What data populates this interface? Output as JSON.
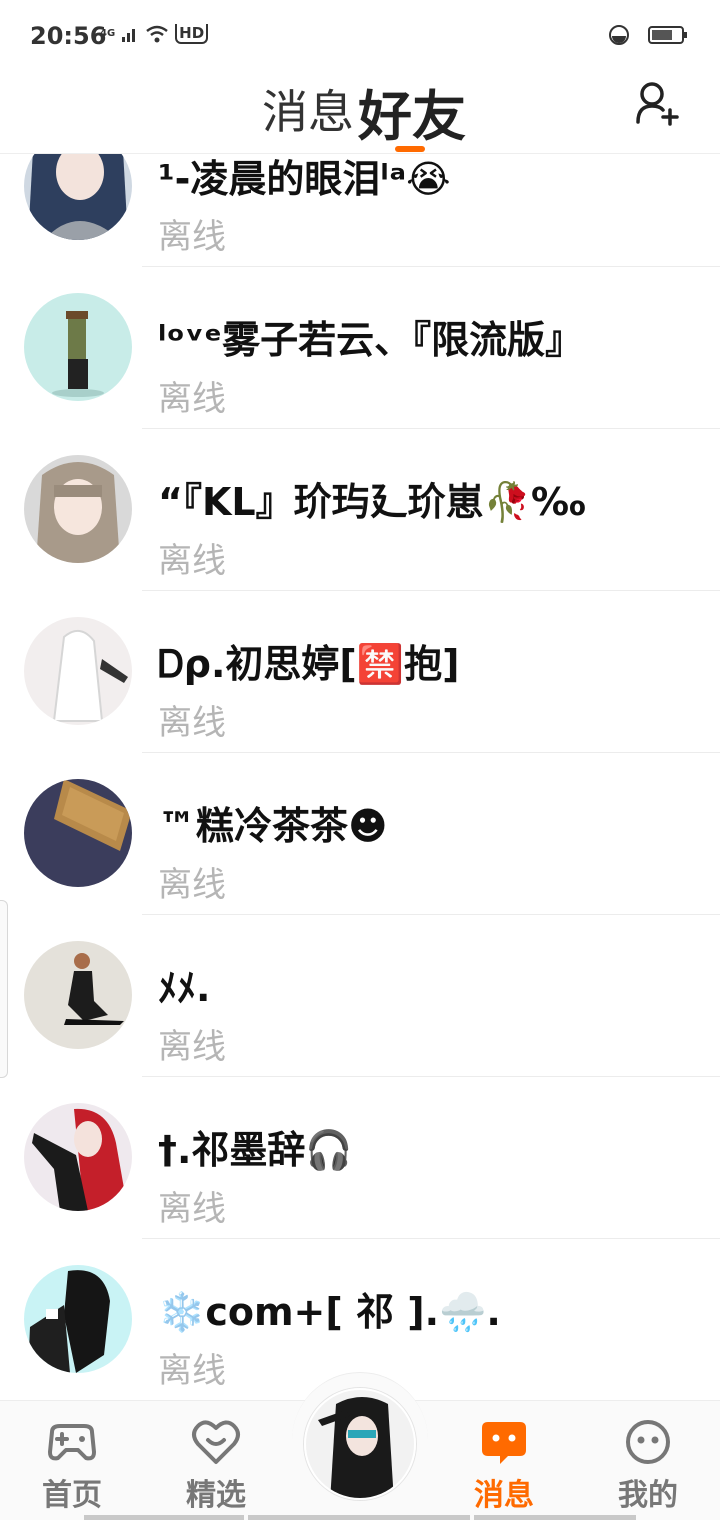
{
  "status_bar": {
    "time": "20:56",
    "network": "4G",
    "hd": "HD"
  },
  "header": {
    "tab_messages": "消息",
    "tab_friends": "好友",
    "accent_color": "#ff6a00"
  },
  "friends": [
    {
      "name": "¹-凌晨的眼泪ˡᵃ😭",
      "status": "离线"
    },
    {
      "name": "ˡᵒᵛᵉ雾子若云、『限流版』",
      "status": "离线"
    },
    {
      "name": "“『KL』玠玙廴玠崽🥀‰",
      "status": "离线"
    },
    {
      "name": "Ꭰρ.初思婷[🈲抱]",
      "status": "离线"
    },
    {
      "name": "™糕冷茶茶☻",
      "status": "离线"
    },
    {
      "name": "ﾒﾒ.",
      "status": "离线"
    },
    {
      "name": "†.祁墨辞🎧",
      "status": "离线"
    },
    {
      "name": "❄️com+[ 祁 ].🌧️.",
      "status": "离线"
    }
  ],
  "bottom_nav": {
    "items": [
      {
        "label": "首页",
        "icon": "gamepad-icon"
      },
      {
        "label": "精选",
        "icon": "heart-chat-icon"
      },
      {
        "label": "消息",
        "icon": "message-icon",
        "active": true
      },
      {
        "label": "我的",
        "icon": "face-icon"
      }
    ]
  }
}
